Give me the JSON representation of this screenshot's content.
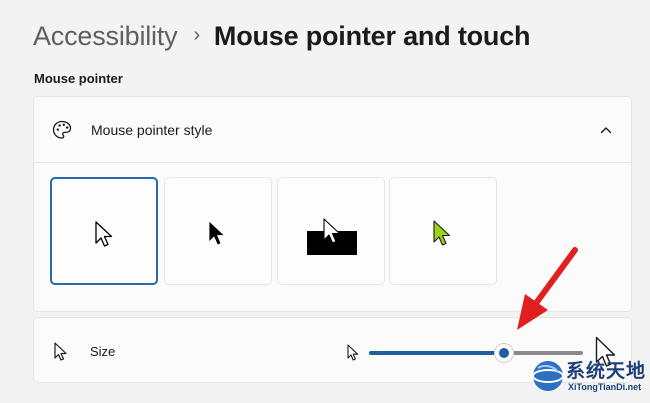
{
  "breadcrumb": {
    "parent": "Accessibility",
    "separator": "›",
    "current": "Mouse pointer and touch"
  },
  "section_label": "Mouse pointer",
  "pointer_style": {
    "label": "Mouse pointer style",
    "icon": "palette-icon",
    "expanded": true,
    "options": [
      {
        "name": "white",
        "selected": true
      },
      {
        "name": "black",
        "selected": false
      },
      {
        "name": "inverted",
        "selected": false
      },
      {
        "name": "custom",
        "selected": false,
        "color": "#9bd418"
      }
    ]
  },
  "size": {
    "label": "Size",
    "icon": "pointer-icon",
    "slider_fraction": 0.63
  },
  "annotation": {
    "color": "#e02020"
  },
  "watermark": {
    "title": "系统天地",
    "subtitle": "XiTongTianDi.net"
  },
  "colors": {
    "accent": "#1f5f9c",
    "selected_border": "#2a69a8",
    "background": "#f3f3f3"
  }
}
